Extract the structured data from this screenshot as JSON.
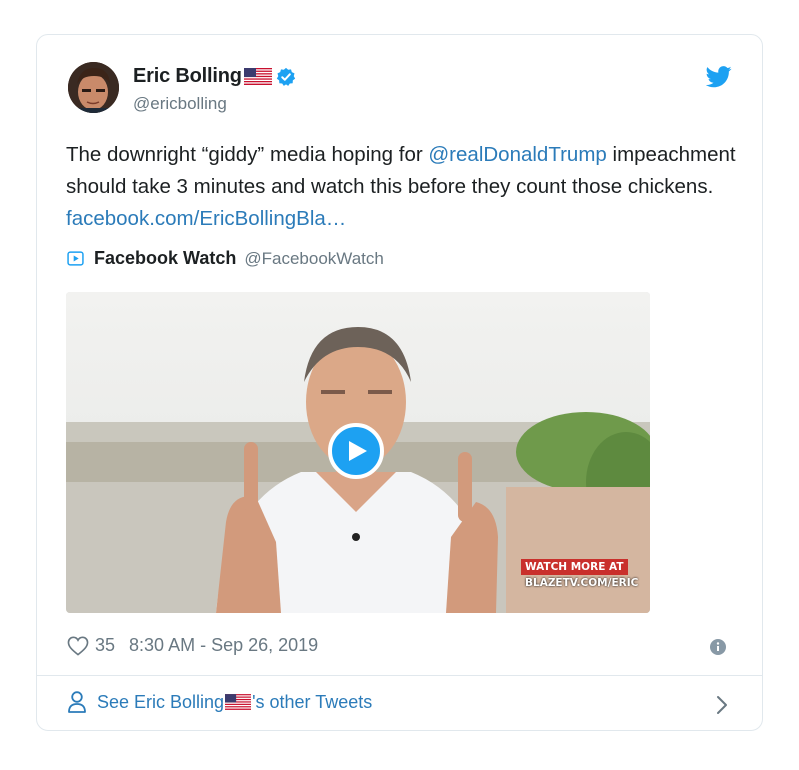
{
  "author": {
    "name": "Eric Bolling",
    "handle": "@ericbolling",
    "flag_icon": "us-flag-icon",
    "verified_icon": "verified-badge-icon"
  },
  "tweet": {
    "text_part1": "The downright “giddy” media hoping for ",
    "mention": "@realDonaldTrump",
    "text_part2": " impeachment should take 3 minutes and watch this before they count those chickens. ",
    "link": "facebook.com/EricBollingBla…"
  },
  "quoted": {
    "name": "Facebook Watch",
    "handle": "@FacebookWatch"
  },
  "video": {
    "watermark_line1": "WATCH MORE AT",
    "watermark_line2": "BLAZETV.COM/ERIC"
  },
  "meta": {
    "likes": "35",
    "timestamp": "8:30 AM - Sep 26, 2019"
  },
  "footer": {
    "prefix": "See Eric Bolling",
    "suffix": "'s other Tweets"
  },
  "colors": {
    "link": "#2b7bb9",
    "twitter_blue": "#1da1f2",
    "muted": "#697882",
    "border": "#e1e8ed"
  }
}
